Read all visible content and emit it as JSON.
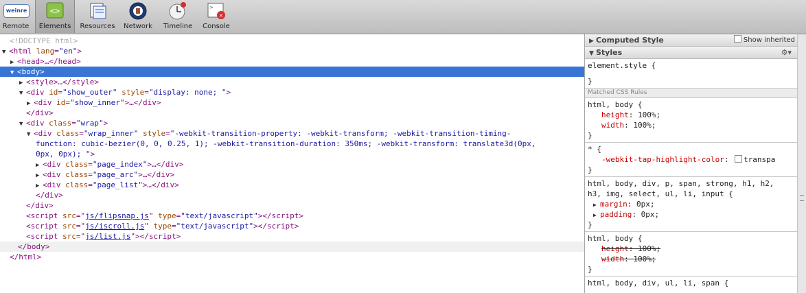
{
  "toolbar": {
    "buttons": [
      {
        "label": "Remote",
        "icon": "weinre-logo-icon"
      },
      {
        "label": "Elements",
        "icon": "elements-icon"
      },
      {
        "label": "Resources",
        "icon": "resources-icon"
      },
      {
        "label": "Network",
        "icon": "network-icon"
      },
      {
        "label": "Timeline",
        "icon": "timeline-icon"
      },
      {
        "label": "Console",
        "icon": "console-icon"
      }
    ],
    "logo_text": "weinre",
    "selected": "Elements"
  },
  "dom": {
    "doctype": "<!DOCTYPE html>",
    "html_open_tag": "<html ",
    "html_lang_attr": "lang",
    "html_lang_val": "\"en\"",
    "head": "<head>…</head>",
    "body_open": "<body>",
    "style": "<style>…</style>",
    "show_outer_tag": "<div ",
    "show_outer_id": "id",
    "show_outer_id_val": "\"show_outer\"",
    "show_outer_style": "style",
    "show_outer_style_val": "\"display: none; \"",
    "show_inner_id_val": "\"show_inner\"",
    "div_close": "</div>",
    "wrap_class_val": "\"wrap\"",
    "wrap_inner_class_val": "\"wrap_inner\"",
    "wrap_inner_style_1": "\"-webkit-transition-property: -webkit-transform; -webkit-transition-timing-",
    "wrap_inner_style_2": "function: cubic-bezier(0, 0, 0.25, 1); -webkit-transition-duration: 350ms; -webkit-transform: translate3d(0px,",
    "wrap_inner_style_3": "0px, 0px); \"",
    "page_index": "\"page_index\"",
    "page_arc": "\"page_arc\"",
    "page_list": "\"page_list\"",
    "script1": "js/flipsnap.js",
    "script2": "js/iscroll.js",
    "script3": "js/list.js",
    "type_val": "\"text/javascript\"",
    "body_close": "</body>",
    "html_close": "</html>"
  },
  "sidebar": {
    "computed_style": "Computed Style",
    "show_inherited": "Show inherited",
    "styles": "Styles",
    "element_style": "element.style {",
    "matched_rules": "Matched CSS Rules",
    "rules": [
      {
        "selector": "html, body {",
        "props": [
          {
            "name": "height",
            "value": "100%;"
          },
          {
            "name": "width",
            "value": "100%;"
          }
        ]
      },
      {
        "selector": "* {",
        "props": [
          {
            "name": "-webkit-tap-highlight-color",
            "value": "transpa"
          }
        ]
      },
      {
        "selector_1": "html, body, div, p, span, strong, h1, h2,",
        "selector_2": "h3, img, select, ul, li, input {",
        "props": [
          {
            "name": "margin",
            "value": "0px;"
          },
          {
            "name": "padding",
            "value": "0px;"
          }
        ]
      },
      {
        "selector": "html, body {",
        "props": [
          {
            "name": "height",
            "value": "100%;"
          },
          {
            "name": "width",
            "value": "100%;"
          }
        ]
      },
      {
        "selector": "html, body, div, ul, li, span {"
      }
    ],
    "close_brace": "}"
  }
}
